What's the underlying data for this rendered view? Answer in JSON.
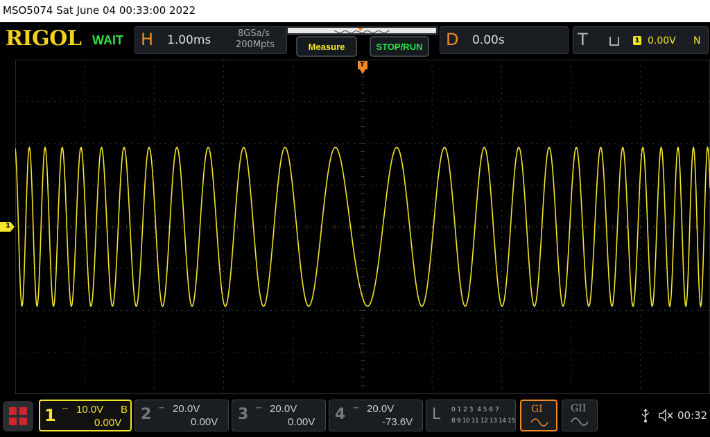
{
  "title_bar": {
    "text": "MSO5074  Sat June 04 00:33:00 2022"
  },
  "brand": {
    "logo": "RIGOL",
    "status": "WAIT"
  },
  "horizontal": {
    "letter": "H",
    "timebase": "1.00ms",
    "sample_rate": "8GSa/s",
    "memory_depth": "200Mpts"
  },
  "buttons": {
    "measure": "Measure",
    "stop_run": "STOP/RUN"
  },
  "delay": {
    "letter": "D",
    "value": "0.00s"
  },
  "trigger": {
    "letter": "T",
    "level_channel": "1",
    "level": "0.00V",
    "sweep": "N"
  },
  "channels": [
    {
      "num": "1",
      "scale": "10.0V",
      "bandwidth": "B",
      "offset": "0.00V",
      "active": true
    },
    {
      "num": "2",
      "scale": "20.0V",
      "offset": "0.00V",
      "active": false
    },
    {
      "num": "3",
      "scale": "20.0V",
      "offset": "0.00V",
      "active": false
    },
    {
      "num": "4",
      "scale": "20.0V",
      "offset": "-73.6V",
      "active": false
    }
  ],
  "logic": {
    "letter": "L",
    "row1": "0 1 2 3  4 5 6 7",
    "row2": "8 9 10 11 12 13 14 15"
  },
  "generators": {
    "g1": "GI",
    "g2": "GII"
  },
  "system": {
    "clock": "00:32",
    "usb_icon": "usb-icon",
    "speaker_icon": "speaker-muted-icon"
  },
  "screen_markers": {
    "channel1_marker": "1",
    "trigger_marker": "T"
  },
  "colors": {
    "channel1": "#f5e42a",
    "orange": "#f08a24",
    "green": "#2ee04a",
    "grid": "#3a3a3a"
  },
  "waveform": {
    "type": "chirp-sine",
    "min_period_divs": 0.2,
    "max_period_divs": 1.1
  }
}
